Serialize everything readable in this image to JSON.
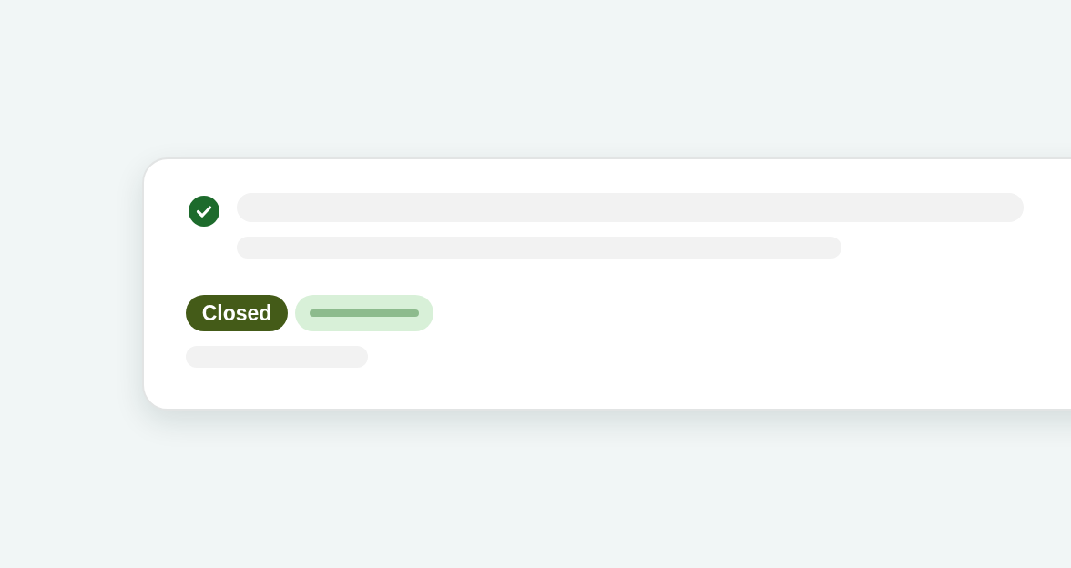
{
  "card": {
    "status": {
      "kind": "done"
    },
    "badges": [
      {
        "kind": "label",
        "label": "Closed"
      },
      {
        "kind": "skeleton"
      }
    ]
  }
}
